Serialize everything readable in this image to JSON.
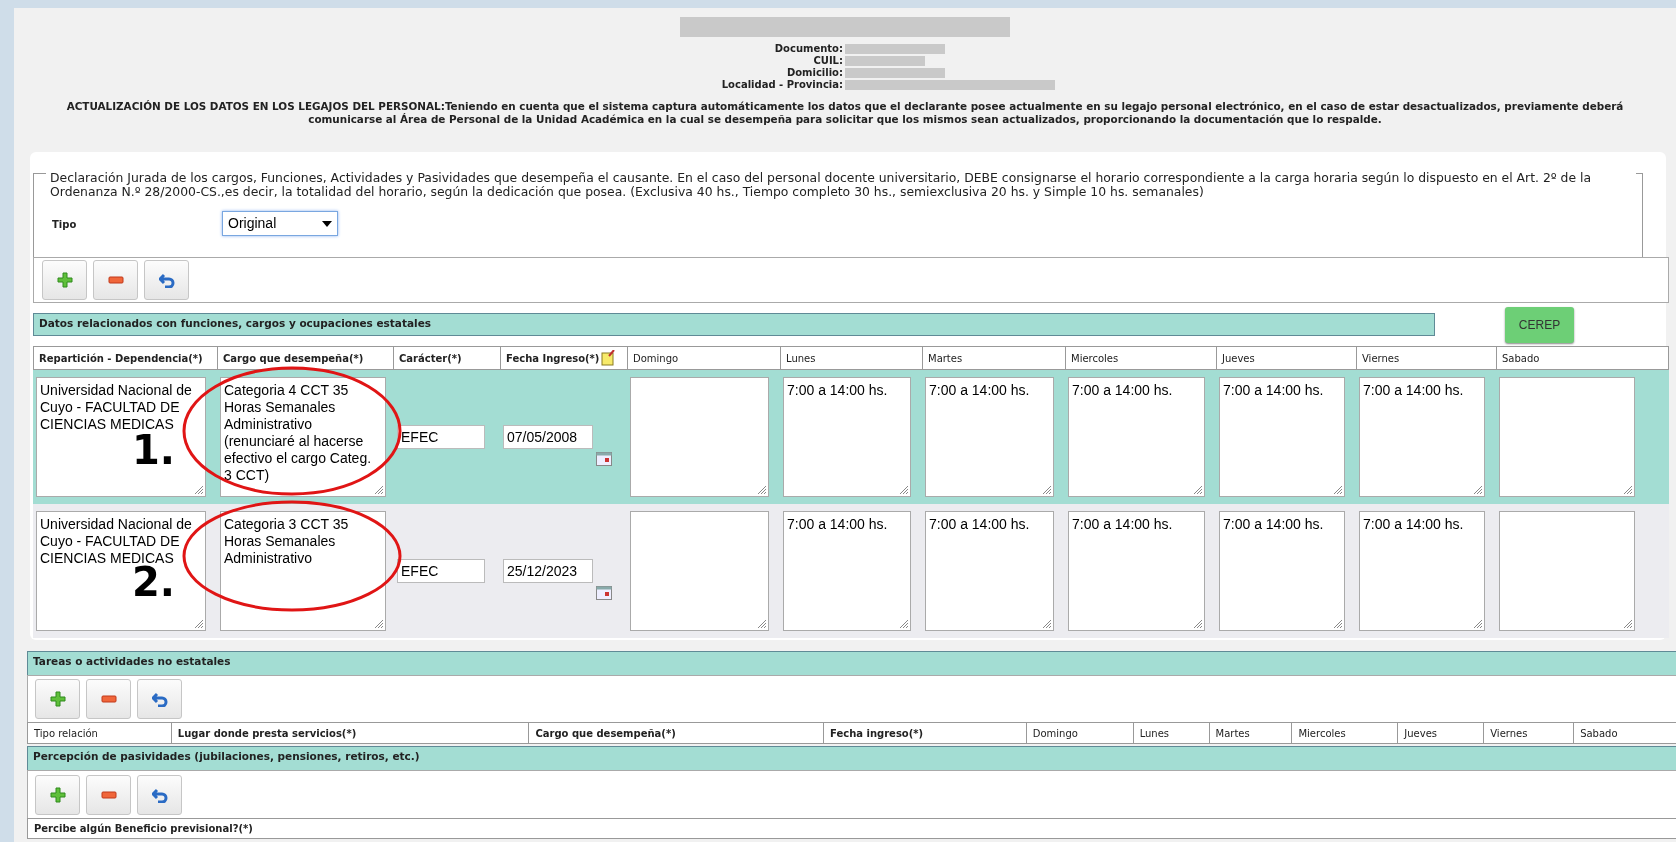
{
  "header": {
    "fields": [
      {
        "label": "Documento:"
      },
      {
        "label": "CUIL:"
      },
      {
        "label": "Domicilio:"
      },
      {
        "label": "Localidad - Provincia:"
      }
    ]
  },
  "notice": "ACTUALIZACIÓN DE LOS DATOS EN LOS LEGAJOS DEL PERSONAL:Teniendo en cuenta que el sistema captura automáticamente los datos que el declarante posee actualmente en su legajo personal electrónico, en el caso de estar desactualizados, previamente deberá comunicarse al Área de Personal de la Unidad Académica en la cual se desempeña para solicitar que los mismos sean actualizados, proporcionando la documentación que lo respalde.",
  "declaration": {
    "legend": "Declaración Jurada de los cargos, Funciones, Actividades y Pasividades que desempeña el causante. En el caso del personal docente universitario, DEBE consignarse el horario correspondiente a la carga horaria según lo dispuesto en el Art. 2º de la Ordenanza N.º 28/2000-CS.,es decir, la totalidad del horario, según la dedicación que posea. (Exclusiva 40 hs., Tiempo completo 30 hs., semiexclusiva 20 hs. y Simple 10 hs. semanales)",
    "tipo_label": "Tipo",
    "tipo_value": "Original"
  },
  "estatales": {
    "title": "Datos relacionados con funciones, cargos y ocupaciones estatales",
    "cerep_button": "CEREP",
    "columns": [
      {
        "label": "Repartición - Dependencia(*)",
        "bold": true
      },
      {
        "label": "Cargo que desempeña(*)",
        "bold": true
      },
      {
        "label": "Carácter(*)",
        "bold": true
      },
      {
        "label": "Fecha Ingreso(*)",
        "bold": true
      },
      {
        "label": "Domingo",
        "bold": false
      },
      {
        "label": "Lunes",
        "bold": false
      },
      {
        "label": "Martes",
        "bold": false
      },
      {
        "label": "Miercoles",
        "bold": false
      },
      {
        "label": "Jueves",
        "bold": false
      },
      {
        "label": "Viernes",
        "bold": false
      },
      {
        "label": "Sabado",
        "bold": false
      }
    ],
    "rows": [
      {
        "selected": true,
        "annotation": "1.",
        "reparticion": "Universidad Nacional de Cuyo - FACULTAD DE CIENCIAS MEDICAS",
        "cargo": "Categoria 4 CCT 35 Horas Semanales Administrativo (renunciaré al hacerse efectivo el cargo Categ. 3 CCT)",
        "caracter": "EFEC",
        "fecha": "07/05/2008",
        "weekday_hours": [
          "7:00 a 14:00 hs.",
          "7:00 a 14:00 hs.",
          "7:00 a 14:00 hs.",
          "7:00 a 14:00 hs.",
          "7:00 a 14:00 hs."
        ]
      },
      {
        "selected": false,
        "annotation": "2.",
        "reparticion": "Universidad Nacional de Cuyo - FACULTAD DE CIENCIAS MEDICAS",
        "cargo": "Categoria 3 CCT 35 Horas Semanales Administrativo",
        "caracter": "EFEC",
        "fecha": "25/12/2023",
        "weekday_hours": [
          "7:00 a 14:00 hs.",
          "7:00 a 14:00 hs.",
          "7:00 a 14:00 hs.",
          "7:00 a 14:00 hs.",
          "7:00 a 14:00 hs."
        ]
      }
    ]
  },
  "no_estatales": {
    "title": "Tareas o actividades no estatales",
    "columns": [
      {
        "label": "Tipo relación",
        "bold": false
      },
      {
        "label": "Lugar donde presta servicios(*)",
        "bold": true
      },
      {
        "label": "Cargo que desempeña(*)",
        "bold": true
      },
      {
        "label": "Fecha ingreso(*)",
        "bold": true
      },
      {
        "label": "Domingo",
        "bold": false
      },
      {
        "label": "Lunes",
        "bold": false
      },
      {
        "label": "Martes",
        "bold": false
      },
      {
        "label": "Miercoles",
        "bold": false
      },
      {
        "label": "Jueves",
        "bold": false
      },
      {
        "label": "Viernes",
        "bold": false
      },
      {
        "label": "Sabado",
        "bold": false
      }
    ]
  },
  "pasividades": {
    "title": "Percepción de pasividades (jubilaciones, pensiones, retiros, etc.)",
    "question": "Percibe algún Beneficio previsional?(*)"
  }
}
